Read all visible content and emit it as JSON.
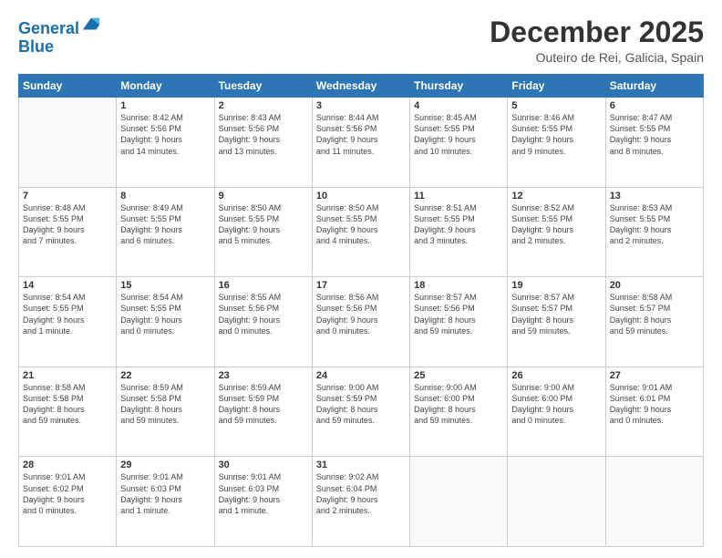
{
  "header": {
    "logo_line1": "General",
    "logo_line2": "Blue",
    "month_title": "December 2025",
    "location": "Outeiro de Rei, Galicia, Spain"
  },
  "weekdays": [
    "Sunday",
    "Monday",
    "Tuesday",
    "Wednesday",
    "Thursday",
    "Friday",
    "Saturday"
  ],
  "weeks": [
    [
      {
        "day": "",
        "info": ""
      },
      {
        "day": "1",
        "info": "Sunrise: 8:42 AM\nSunset: 5:56 PM\nDaylight: 9 hours\nand 14 minutes."
      },
      {
        "day": "2",
        "info": "Sunrise: 8:43 AM\nSunset: 5:56 PM\nDaylight: 9 hours\nand 13 minutes."
      },
      {
        "day": "3",
        "info": "Sunrise: 8:44 AM\nSunset: 5:56 PM\nDaylight: 9 hours\nand 11 minutes."
      },
      {
        "day": "4",
        "info": "Sunrise: 8:45 AM\nSunset: 5:55 PM\nDaylight: 9 hours\nand 10 minutes."
      },
      {
        "day": "5",
        "info": "Sunrise: 8:46 AM\nSunset: 5:55 PM\nDaylight: 9 hours\nand 9 minutes."
      },
      {
        "day": "6",
        "info": "Sunrise: 8:47 AM\nSunset: 5:55 PM\nDaylight: 9 hours\nand 8 minutes."
      }
    ],
    [
      {
        "day": "7",
        "info": "Sunrise: 8:48 AM\nSunset: 5:55 PM\nDaylight: 9 hours\nand 7 minutes."
      },
      {
        "day": "8",
        "info": "Sunrise: 8:49 AM\nSunset: 5:55 PM\nDaylight: 9 hours\nand 6 minutes."
      },
      {
        "day": "9",
        "info": "Sunrise: 8:50 AM\nSunset: 5:55 PM\nDaylight: 9 hours\nand 5 minutes."
      },
      {
        "day": "10",
        "info": "Sunrise: 8:50 AM\nSunset: 5:55 PM\nDaylight: 9 hours\nand 4 minutes."
      },
      {
        "day": "11",
        "info": "Sunrise: 8:51 AM\nSunset: 5:55 PM\nDaylight: 9 hours\nand 3 minutes."
      },
      {
        "day": "12",
        "info": "Sunrise: 8:52 AM\nSunset: 5:55 PM\nDaylight: 9 hours\nand 2 minutes."
      },
      {
        "day": "13",
        "info": "Sunrise: 8:53 AM\nSunset: 5:55 PM\nDaylight: 9 hours\nand 2 minutes."
      }
    ],
    [
      {
        "day": "14",
        "info": "Sunrise: 8:54 AM\nSunset: 5:55 PM\nDaylight: 9 hours\nand 1 minute."
      },
      {
        "day": "15",
        "info": "Sunrise: 8:54 AM\nSunset: 5:55 PM\nDaylight: 9 hours\nand 0 minutes."
      },
      {
        "day": "16",
        "info": "Sunrise: 8:55 AM\nSunset: 5:56 PM\nDaylight: 9 hours\nand 0 minutes."
      },
      {
        "day": "17",
        "info": "Sunrise: 8:56 AM\nSunset: 5:56 PM\nDaylight: 9 hours\nand 0 minutes."
      },
      {
        "day": "18",
        "info": "Sunrise: 8:57 AM\nSunset: 5:56 PM\nDaylight: 8 hours\nand 59 minutes."
      },
      {
        "day": "19",
        "info": "Sunrise: 8:57 AM\nSunset: 5:57 PM\nDaylight: 8 hours\nand 59 minutes."
      },
      {
        "day": "20",
        "info": "Sunrise: 8:58 AM\nSunset: 5:57 PM\nDaylight: 8 hours\nand 59 minutes."
      }
    ],
    [
      {
        "day": "21",
        "info": "Sunrise: 8:58 AM\nSunset: 5:58 PM\nDaylight: 8 hours\nand 59 minutes."
      },
      {
        "day": "22",
        "info": "Sunrise: 8:59 AM\nSunset: 5:58 PM\nDaylight: 8 hours\nand 59 minutes."
      },
      {
        "day": "23",
        "info": "Sunrise: 8:59 AM\nSunset: 5:59 PM\nDaylight: 8 hours\nand 59 minutes."
      },
      {
        "day": "24",
        "info": "Sunrise: 9:00 AM\nSunset: 5:59 PM\nDaylight: 8 hours\nand 59 minutes."
      },
      {
        "day": "25",
        "info": "Sunrise: 9:00 AM\nSunset: 6:00 PM\nDaylight: 8 hours\nand 59 minutes."
      },
      {
        "day": "26",
        "info": "Sunrise: 9:00 AM\nSunset: 6:00 PM\nDaylight: 9 hours\nand 0 minutes."
      },
      {
        "day": "27",
        "info": "Sunrise: 9:01 AM\nSunset: 6:01 PM\nDaylight: 9 hours\nand 0 minutes."
      }
    ],
    [
      {
        "day": "28",
        "info": "Sunrise: 9:01 AM\nSunset: 6:02 PM\nDaylight: 9 hours\nand 0 minutes."
      },
      {
        "day": "29",
        "info": "Sunrise: 9:01 AM\nSunset: 6:03 PM\nDaylight: 9 hours\nand 1 minute."
      },
      {
        "day": "30",
        "info": "Sunrise: 9:01 AM\nSunset: 6:03 PM\nDaylight: 9 hours\nand 1 minute."
      },
      {
        "day": "31",
        "info": "Sunrise: 9:02 AM\nSunset: 6:04 PM\nDaylight: 9 hours\nand 2 minutes."
      },
      {
        "day": "",
        "info": ""
      },
      {
        "day": "",
        "info": ""
      },
      {
        "day": "",
        "info": ""
      }
    ]
  ]
}
